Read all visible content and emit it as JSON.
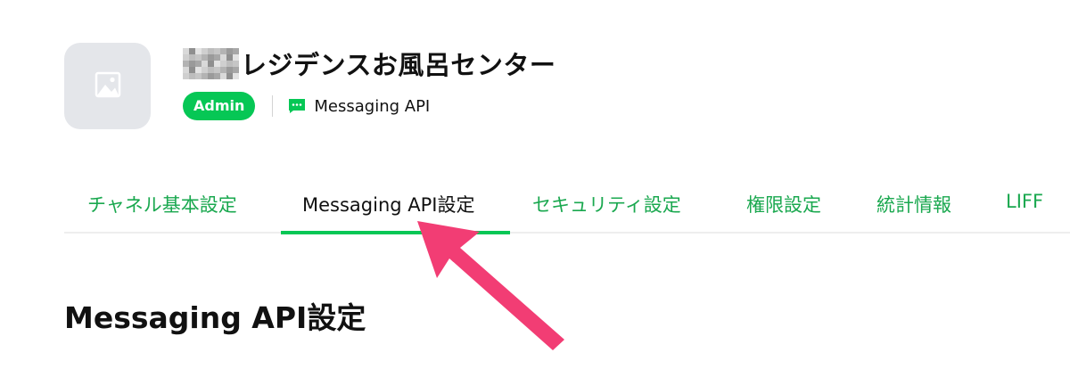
{
  "channel": {
    "icon": "image-placeholder-icon",
    "name": "レジデンスお風呂センター",
    "name_prefix_redacted": true,
    "role": "Admin",
    "type_icon": "chat-bubble-icon",
    "type": "Messaging API"
  },
  "tabs": [
    {
      "label": "チャネル基本設定",
      "active": false
    },
    {
      "label": "Messaging API設定",
      "active": true
    },
    {
      "label": "セキュリティ設定",
      "active": false
    },
    {
      "label": "権限設定",
      "active": false
    },
    {
      "label": "統計情報",
      "active": false
    },
    {
      "label": "LIFF",
      "active": false
    }
  ],
  "section": {
    "title": "Messaging API設定"
  },
  "annotation": {
    "icon": "pointer-arrow-icon",
    "color": "#f23d74"
  },
  "colors": {
    "accent": "#06c755",
    "tab_text": "#1aa84f",
    "icon_bg": "#e4e6ea"
  }
}
